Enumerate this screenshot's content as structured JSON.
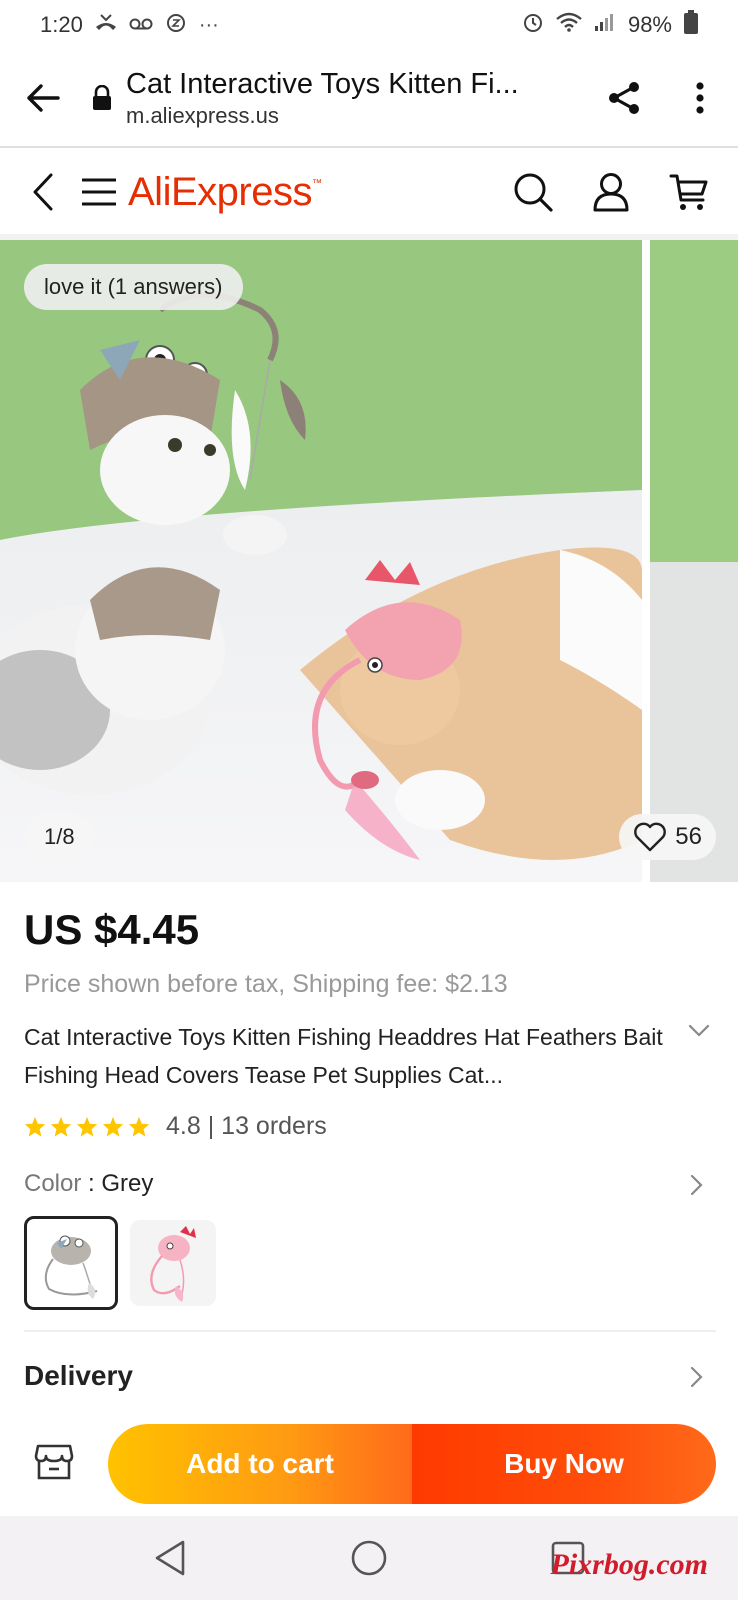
{
  "status_bar": {
    "time": "1:20",
    "battery": "98%",
    "more_indicator": "···"
  },
  "browser": {
    "page_title": "Cat Interactive Toys Kitten Fi...",
    "url": "m.aliexpress.us"
  },
  "header": {
    "logo": "AliExpress",
    "icons": [
      "back-icon",
      "menu-icon",
      "search-icon",
      "account-icon",
      "cart-icon"
    ]
  },
  "gallery": {
    "qa_badge": "love it (1 answers)",
    "counter": "1/8",
    "wishlist_count": "56"
  },
  "product": {
    "price": "US $4.45",
    "tax_note": "Price shown before tax, Shipping fee: $2.13",
    "title": "Cat Interactive Toys Kitten Fishing Headdres Hat Feathers Bait Fishing Head Covers Tease Pet Supplies Cat...",
    "rating": "4.8",
    "rating_sep": "|",
    "orders": "13 orders",
    "stars": 5,
    "color_label": "Color",
    "color_value": "Grey",
    "colors": [
      "Grey",
      "Pink"
    ],
    "delivery_label": "Delivery"
  },
  "actions": {
    "add_to_cart": "Add to cart",
    "buy_now": "Buy Now"
  },
  "watermark": "Pixrbog.com",
  "colors": {
    "brand": "#e62e04",
    "star": "#ffc600",
    "cart_button": "#ff9a12",
    "buy_button": "#ff3a00"
  }
}
